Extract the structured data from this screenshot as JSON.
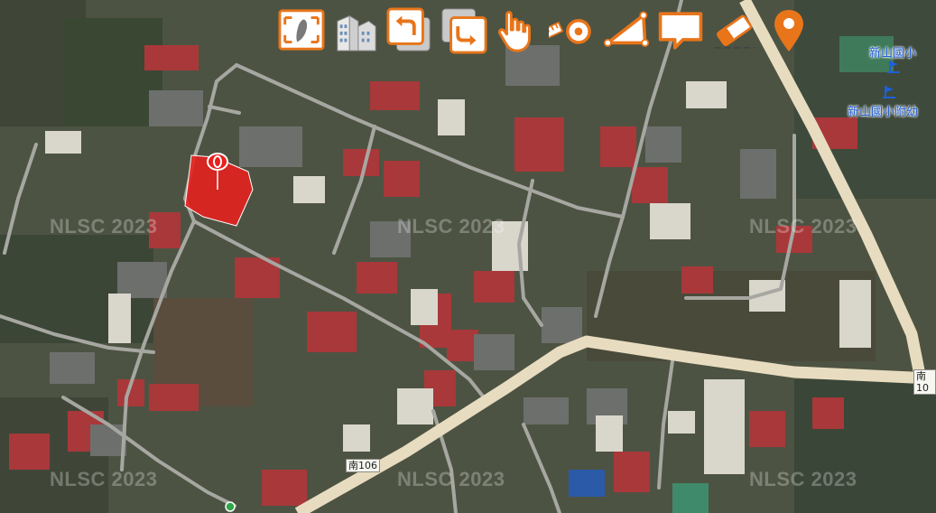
{
  "toolbar": {
    "buttons": [
      {
        "name": "taiwan-map-icon",
        "label": "full-extent"
      },
      {
        "name": "buildings-icon",
        "label": "3d-buildings"
      },
      {
        "name": "undo-icon",
        "label": "previous-view"
      },
      {
        "name": "redo-icon",
        "label": "next-view"
      },
      {
        "name": "hand-pointer-icon",
        "label": "pan"
      },
      {
        "name": "ruler-icon",
        "label": "measure-distance"
      },
      {
        "name": "area-measure-icon",
        "label": "measure-area"
      },
      {
        "name": "comment-icon",
        "label": "annotation"
      },
      {
        "name": "eraser-icon",
        "label": "clear"
      },
      {
        "name": "location-pin-icon",
        "label": "locate"
      }
    ]
  },
  "watermark": "NLSC 2023",
  "poi": {
    "school": "新山國小",
    "kindergarten": "新山國小附幼"
  },
  "roads": {
    "label_main": "南106",
    "label_edge": "南10"
  },
  "colors": {
    "accent": "#e8751a",
    "parcel": "#e8201c",
    "poi_text": "#1f5fd6",
    "road": "#e8dcc0"
  }
}
